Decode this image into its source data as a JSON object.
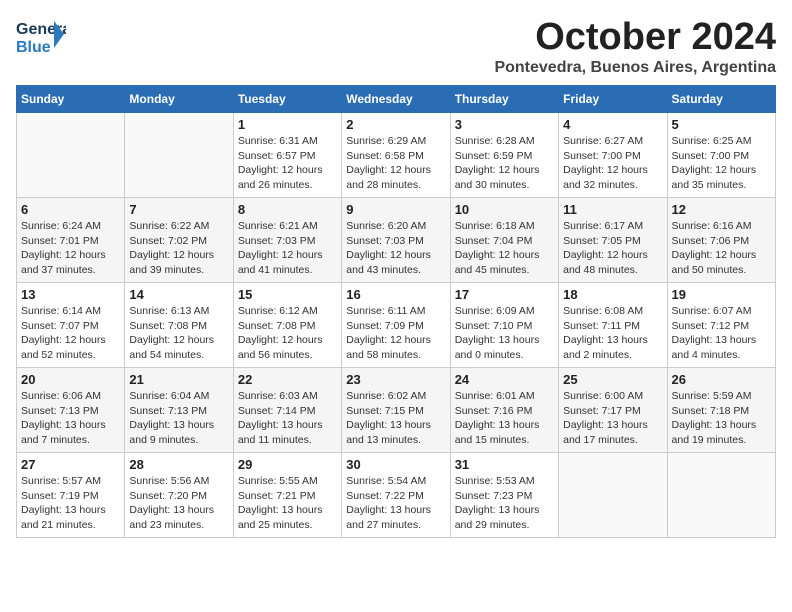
{
  "header": {
    "logo_line1": "General",
    "logo_line2": "Blue",
    "month_title": "October 2024",
    "location": "Pontevedra, Buenos Aires, Argentina"
  },
  "days_of_week": [
    "Sunday",
    "Monday",
    "Tuesday",
    "Wednesday",
    "Thursday",
    "Friday",
    "Saturday"
  ],
  "weeks": [
    [
      {
        "day": "",
        "content": ""
      },
      {
        "day": "",
        "content": ""
      },
      {
        "day": "1",
        "content": "Sunrise: 6:31 AM\nSunset: 6:57 PM\nDaylight: 12 hours\nand 26 minutes."
      },
      {
        "day": "2",
        "content": "Sunrise: 6:29 AM\nSunset: 6:58 PM\nDaylight: 12 hours\nand 28 minutes."
      },
      {
        "day": "3",
        "content": "Sunrise: 6:28 AM\nSunset: 6:59 PM\nDaylight: 12 hours\nand 30 minutes."
      },
      {
        "day": "4",
        "content": "Sunrise: 6:27 AM\nSunset: 7:00 PM\nDaylight: 12 hours\nand 32 minutes."
      },
      {
        "day": "5",
        "content": "Sunrise: 6:25 AM\nSunset: 7:00 PM\nDaylight: 12 hours\nand 35 minutes."
      }
    ],
    [
      {
        "day": "6",
        "content": "Sunrise: 6:24 AM\nSunset: 7:01 PM\nDaylight: 12 hours\nand 37 minutes."
      },
      {
        "day": "7",
        "content": "Sunrise: 6:22 AM\nSunset: 7:02 PM\nDaylight: 12 hours\nand 39 minutes."
      },
      {
        "day": "8",
        "content": "Sunrise: 6:21 AM\nSunset: 7:03 PM\nDaylight: 12 hours\nand 41 minutes."
      },
      {
        "day": "9",
        "content": "Sunrise: 6:20 AM\nSunset: 7:03 PM\nDaylight: 12 hours\nand 43 minutes."
      },
      {
        "day": "10",
        "content": "Sunrise: 6:18 AM\nSunset: 7:04 PM\nDaylight: 12 hours\nand 45 minutes."
      },
      {
        "day": "11",
        "content": "Sunrise: 6:17 AM\nSunset: 7:05 PM\nDaylight: 12 hours\nand 48 minutes."
      },
      {
        "day": "12",
        "content": "Sunrise: 6:16 AM\nSunset: 7:06 PM\nDaylight: 12 hours\nand 50 minutes."
      }
    ],
    [
      {
        "day": "13",
        "content": "Sunrise: 6:14 AM\nSunset: 7:07 PM\nDaylight: 12 hours\nand 52 minutes."
      },
      {
        "day": "14",
        "content": "Sunrise: 6:13 AM\nSunset: 7:08 PM\nDaylight: 12 hours\nand 54 minutes."
      },
      {
        "day": "15",
        "content": "Sunrise: 6:12 AM\nSunset: 7:08 PM\nDaylight: 12 hours\nand 56 minutes."
      },
      {
        "day": "16",
        "content": "Sunrise: 6:11 AM\nSunset: 7:09 PM\nDaylight: 12 hours\nand 58 minutes."
      },
      {
        "day": "17",
        "content": "Sunrise: 6:09 AM\nSunset: 7:10 PM\nDaylight: 13 hours\nand 0 minutes."
      },
      {
        "day": "18",
        "content": "Sunrise: 6:08 AM\nSunset: 7:11 PM\nDaylight: 13 hours\nand 2 minutes."
      },
      {
        "day": "19",
        "content": "Sunrise: 6:07 AM\nSunset: 7:12 PM\nDaylight: 13 hours\nand 4 minutes."
      }
    ],
    [
      {
        "day": "20",
        "content": "Sunrise: 6:06 AM\nSunset: 7:13 PM\nDaylight: 13 hours\nand 7 minutes."
      },
      {
        "day": "21",
        "content": "Sunrise: 6:04 AM\nSunset: 7:13 PM\nDaylight: 13 hours\nand 9 minutes."
      },
      {
        "day": "22",
        "content": "Sunrise: 6:03 AM\nSunset: 7:14 PM\nDaylight: 13 hours\nand 11 minutes."
      },
      {
        "day": "23",
        "content": "Sunrise: 6:02 AM\nSunset: 7:15 PM\nDaylight: 13 hours\nand 13 minutes."
      },
      {
        "day": "24",
        "content": "Sunrise: 6:01 AM\nSunset: 7:16 PM\nDaylight: 13 hours\nand 15 minutes."
      },
      {
        "day": "25",
        "content": "Sunrise: 6:00 AM\nSunset: 7:17 PM\nDaylight: 13 hours\nand 17 minutes."
      },
      {
        "day": "26",
        "content": "Sunrise: 5:59 AM\nSunset: 7:18 PM\nDaylight: 13 hours\nand 19 minutes."
      }
    ],
    [
      {
        "day": "27",
        "content": "Sunrise: 5:57 AM\nSunset: 7:19 PM\nDaylight: 13 hours\nand 21 minutes."
      },
      {
        "day": "28",
        "content": "Sunrise: 5:56 AM\nSunset: 7:20 PM\nDaylight: 13 hours\nand 23 minutes."
      },
      {
        "day": "29",
        "content": "Sunrise: 5:55 AM\nSunset: 7:21 PM\nDaylight: 13 hours\nand 25 minutes."
      },
      {
        "day": "30",
        "content": "Sunrise: 5:54 AM\nSunset: 7:22 PM\nDaylight: 13 hours\nand 27 minutes."
      },
      {
        "day": "31",
        "content": "Sunrise: 5:53 AM\nSunset: 7:23 PM\nDaylight: 13 hours\nand 29 minutes."
      },
      {
        "day": "",
        "content": ""
      },
      {
        "day": "",
        "content": ""
      }
    ]
  ]
}
